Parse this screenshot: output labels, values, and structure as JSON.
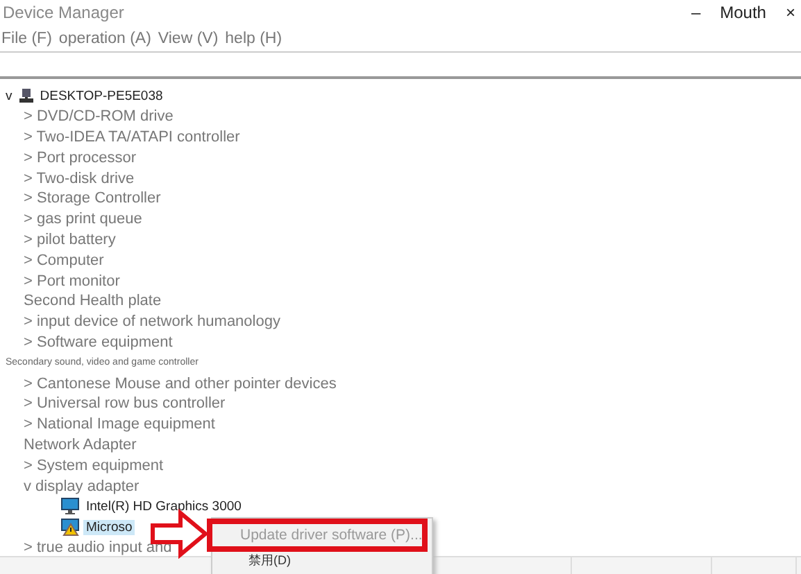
{
  "window": {
    "title": "Device Manager",
    "controls": [
      "–",
      "Mouth",
      "×"
    ]
  },
  "menu_bar": [
    "File (F)",
    "operation (A)",
    "View (V)",
    "help (H)"
  ],
  "tree": {
    "label": "DESKTOP-PE5E038",
    "toggle": "v",
    "children": [
      {
        "label": "> DVD/CD-ROM drive",
        "kind": "category"
      },
      {
        "label": "> Two-IDEA TA/ATAPI controller",
        "kind": "category"
      },
      {
        "label": "> Port processor",
        "kind": "category"
      },
      {
        "label": "> Two-disk drive",
        "kind": "category"
      },
      {
        "label": "> Storage Controller",
        "kind": "category"
      },
      {
        "label": "> gas print queue",
        "kind": "category"
      },
      {
        "label": "> pilot battery",
        "kind": "category"
      },
      {
        "label": "> Computer",
        "kind": "category"
      },
      {
        "label": "> Port monitor",
        "kind": "category"
      },
      {
        "label": "Second Health plate",
        "kind": "category"
      },
      {
        "label": "> input device of network humanology",
        "kind": "category"
      },
      {
        "label": "> Software equipment",
        "kind": "category"
      },
      {
        "label": "Secondary sound, video and game controller",
        "kind": "small"
      },
      {
        "label": "> Cantonese Mouse and other pointer devices",
        "kind": "category"
      },
      {
        "label": "> Universal row bus controller",
        "kind": "category"
      },
      {
        "label": "> National Image equipment",
        "kind": "category"
      },
      {
        "label": "Network Adapter",
        "kind": "category"
      },
      {
        "label": "> System equipment",
        "kind": "category"
      },
      {
        "label": "v display adapter",
        "kind": "category",
        "children": [
          {
            "label": "Intel(R) HD Graphics 3000",
            "kind": "device",
            "selected": false,
            "warning": false
          },
          {
            "label": "Microso",
            "kind": "device",
            "selected": true,
            "warning": true
          }
        ]
      },
      {
        "label": "> true audio input and",
        "kind": "category"
      }
    ]
  },
  "context_menu": {
    "items": [
      {
        "label": "Update driver software (P)...",
        "highlighted": true
      },
      {
        "label": "禁用(D)",
        "highlighted": false
      }
    ]
  }
}
